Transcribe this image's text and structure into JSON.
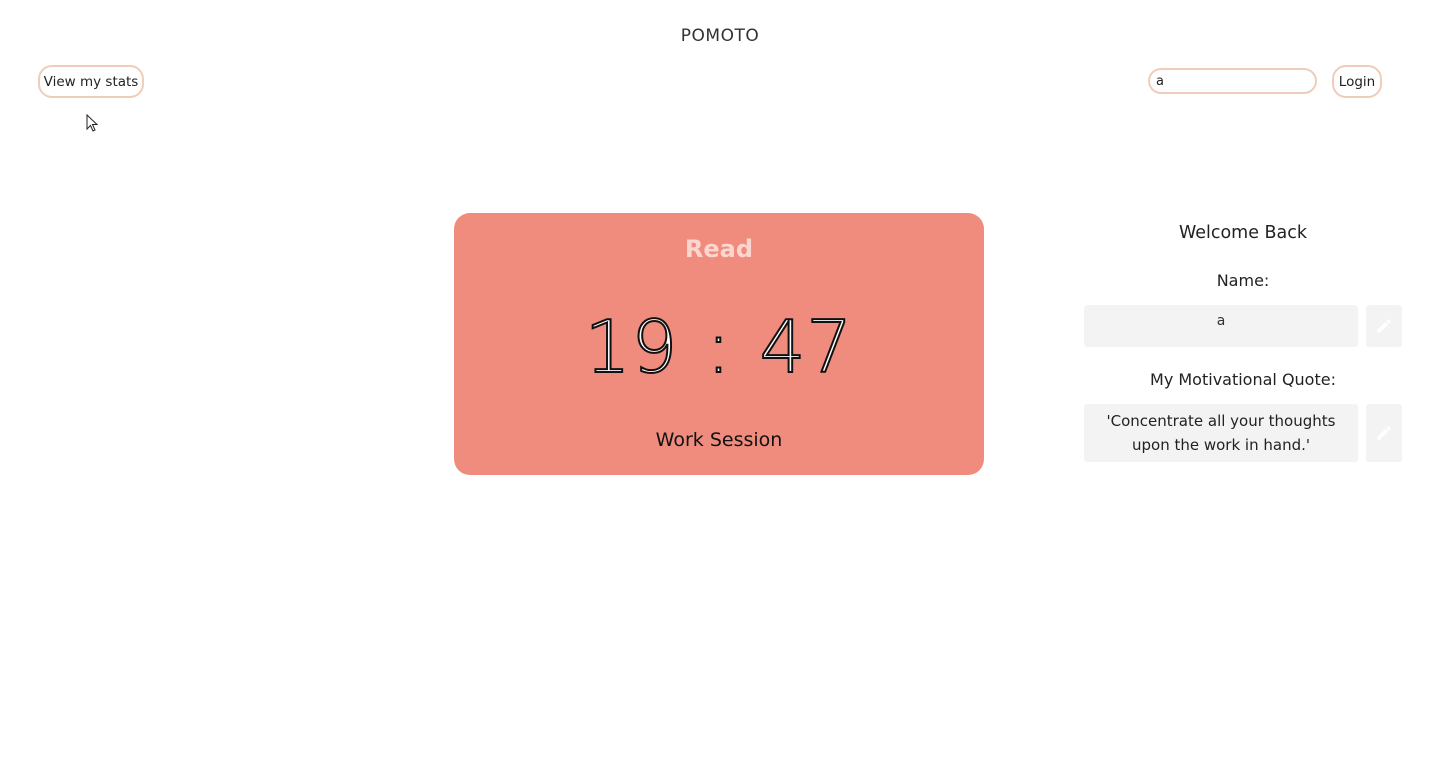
{
  "header": {
    "app_title": "POMOTO",
    "stats_button_label": "View my stats",
    "login_input_value": "a",
    "login_button_label": "Login"
  },
  "timer": {
    "task_name": "Read",
    "minutes": "19",
    "separator": ":",
    "seconds": "47",
    "session_label": "Work Session"
  },
  "profile": {
    "welcome_heading": "Welcome Back",
    "name_label": "Name:",
    "name_value": "a",
    "quote_label": "My Motivational Quote:",
    "quote_value": "'Concentrate all your thoughts upon the work in hand.'"
  },
  "icons": {
    "edit_name": "pencil-icon",
    "edit_quote": "pencil-icon",
    "cursor": "mouse-pointer-icon"
  },
  "colors": {
    "timer_card_background": "#ef8c7d",
    "task_name_color": "#fbd6cf",
    "button_border": "#f0cdb8",
    "field_background": "#f3f3f3"
  }
}
